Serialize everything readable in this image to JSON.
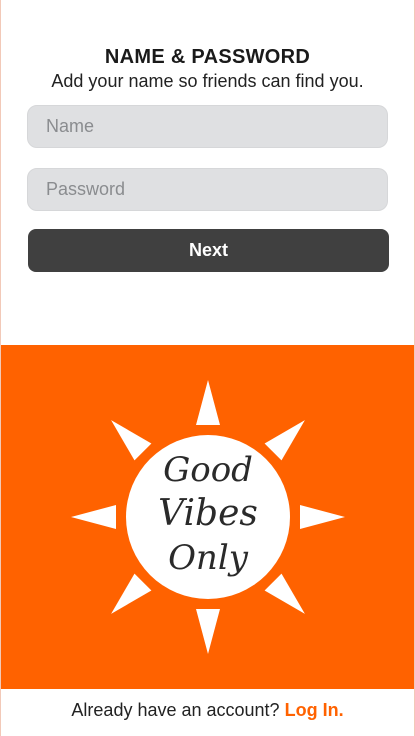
{
  "colors": {
    "accent": "#ff6200",
    "button_bg": "#404040",
    "field_bg": "#dfe0e2"
  },
  "header": {
    "title": "NAME & PASSWORD",
    "subtitle": "Add your name so friends can find you."
  },
  "form": {
    "name_placeholder": "Name",
    "password_placeholder": "Password",
    "next_label": "Next"
  },
  "hero": {
    "icon": "sun-icon",
    "lines": [
      "Good",
      "Vibes",
      "Only"
    ]
  },
  "footer": {
    "prompt": "Already have an account?",
    "login_label": "Log In."
  }
}
